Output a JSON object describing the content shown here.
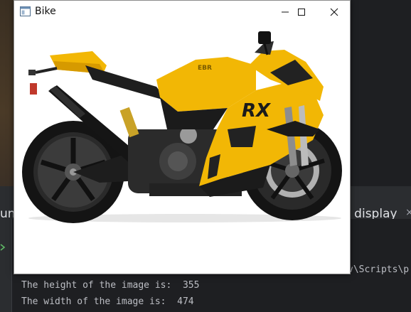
{
  "window": {
    "title": "Bike",
    "icon": "app-window-icon",
    "controls": {
      "minimize": "minimize-icon",
      "maximize": "maximize-icon",
      "close": "close-icon"
    }
  },
  "image": {
    "subject": "yellow sport motorcycle",
    "brand_badge": "EBR",
    "fairing_logo": "RX"
  },
  "ide": {
    "tab_left_fragment": "un",
    "tab_right_fragment": "n display",
    "tab_close_glyph": "×",
    "console": {
      "path_fragment": "v\\Scripts\\p",
      "line_height": "The height of the image is:  355",
      "line_width": "The width of the image is:  474"
    }
  },
  "colors": {
    "bike_yellow": "#f2b705",
    "ide_bg": "#1e1f22",
    "ide_panel": "#2b2d30",
    "console_text": "#bcbec4"
  }
}
